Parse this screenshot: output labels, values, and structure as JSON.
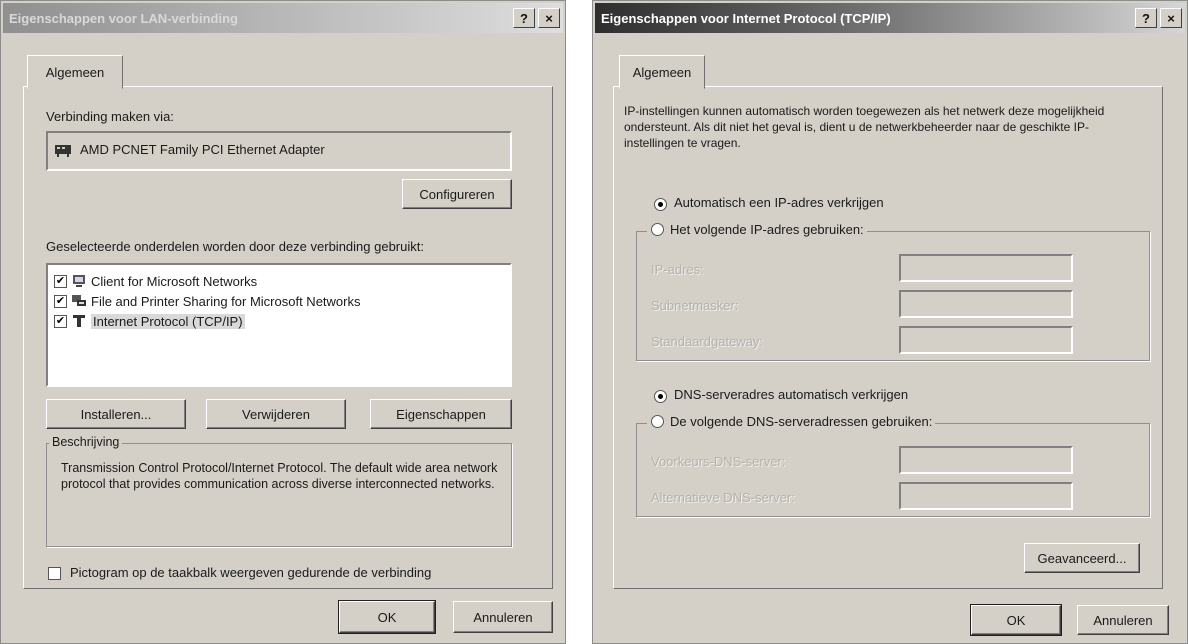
{
  "left_dialog": {
    "title": "Eigenschappen voor LAN-verbinding",
    "help_label": "?",
    "close_label": "×",
    "tab_label": "Algemeen",
    "connect_via_label": "Verbinding maken via:",
    "adapter_name": "AMD PCNET Family PCI Ethernet Adapter",
    "configure_label": "Configureren",
    "components_label": "Geselecteerde onderdelen worden door deze verbinding gebruikt:",
    "components": [
      {
        "label": "Client for Microsoft Networks",
        "checked": true,
        "icon": "network-client-icon"
      },
      {
        "label": "File and Printer Sharing for Microsoft Networks",
        "checked": true,
        "icon": "file-printer-sharing-icon"
      },
      {
        "label": "Internet Protocol (TCP/IP)",
        "checked": true,
        "icon": "protocol-icon"
      }
    ],
    "check_mark": "✔",
    "install_label": "Installeren...",
    "remove_label": "Verwijderen",
    "properties_label": "Eigenschappen",
    "description_legend": "Beschrijving",
    "description_text": "Transmission Control Protocol/Internet Protocol. The default wide area network protocol that provides communication across diverse interconnected networks.",
    "show_icon_label": "Pictogram op de taakbalk weergeven gedurende de verbinding",
    "show_icon_checked": false,
    "ok_label": "OK",
    "cancel_label": "Annuleren"
  },
  "right_dialog": {
    "title": "Eigenschappen voor Internet Protocol (TCP/IP)",
    "help_label": "?",
    "close_label": "×",
    "tab_label": "Algemeen",
    "intro_text": "IP-instellingen kunnen automatisch worden toegewezen als het netwerk deze mogelijkheid ondersteunt. Als dit niet het geval is, dient u de netwerkbeheerder naar de geschikte IP-instellingen te vragen.",
    "auto_ip_label": "Automatisch een IP-adres verkrijgen",
    "auto_ip_selected": true,
    "manual_ip_label": "Het volgende IP-adres gebruiken:",
    "manual_ip_selected": false,
    "ip_address_label": "IP-adres:",
    "subnet_label": "Subnetmasker:",
    "gateway_label": "Standaardgateway:",
    "auto_dns_label": "DNS-serveradres automatisch verkrijgen",
    "auto_dns_selected": true,
    "manual_dns_label": "De volgende DNS-serveradressen gebruiken:",
    "manual_dns_selected": false,
    "preferred_dns_label": "Voorkeurs-DNS-server:",
    "alternate_dns_label": "Alternatieve DNS-server:",
    "advanced_label": "Geavanceerd...",
    "ok_label": "OK",
    "cancel_label": "Annuleren"
  }
}
